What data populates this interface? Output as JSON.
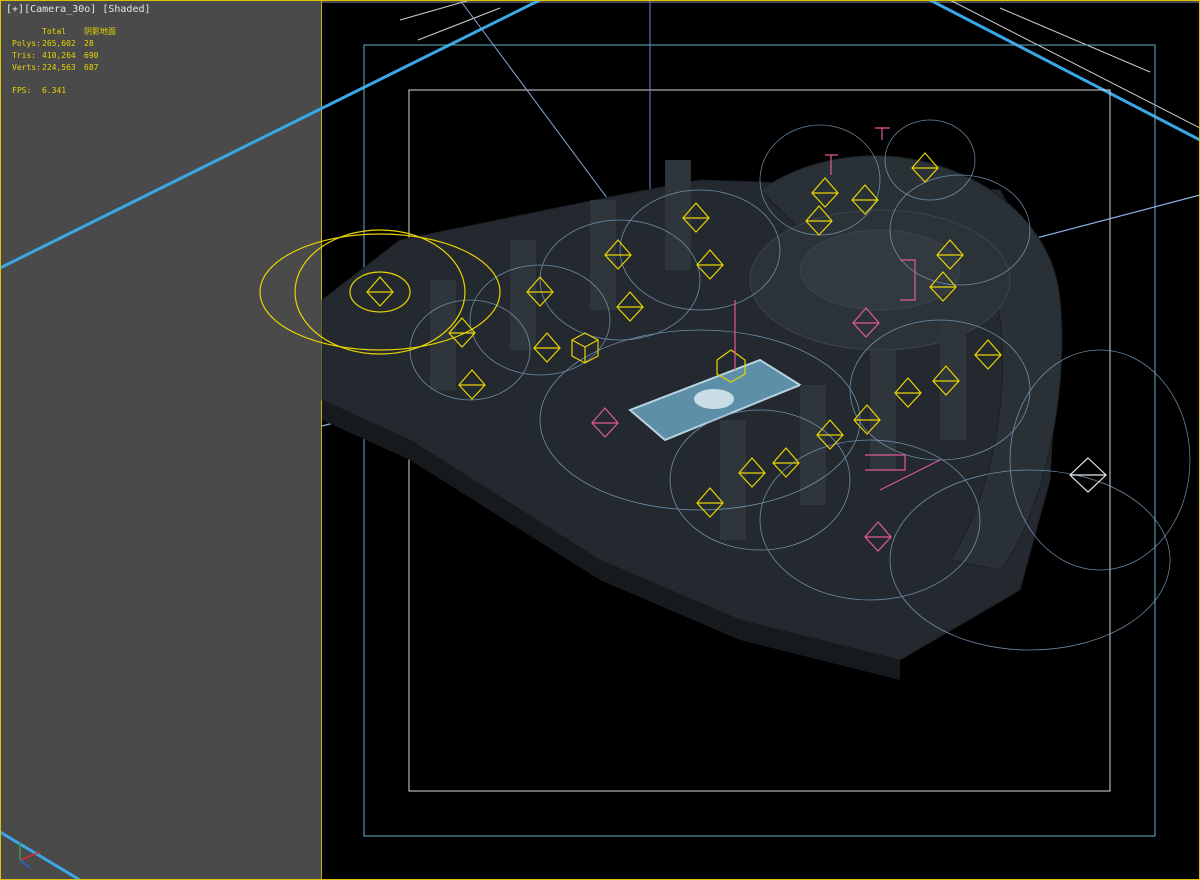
{
  "viewport": {
    "menu_label": "[+]",
    "camera_label": "[Camera_30o]",
    "shading_label": "[Shaded]"
  },
  "stats": {
    "col_total": "Total",
    "col_selection": "阴影地面",
    "rows": [
      {
        "label": "Polys:",
        "total": "265,602",
        "selection": "28"
      },
      {
        "label": "Tris:",
        "total": "410,264",
        "selection": "690"
      },
      {
        "label": "Verts:",
        "total": "224,563",
        "selection": "687"
      }
    ],
    "fps_label": "FPS:",
    "fps_value": "6.341"
  },
  "colors": {
    "background": "#000000",
    "panel_grey": "#4a4a4a",
    "active_border": "#d8c400",
    "safe_frame_outer": "#5fb3c8",
    "safe_frame_inner": "#d9d9d9",
    "light_gizmo": "#e8d400",
    "helper_pink": "#e05a9a",
    "camera_line": "#3aa7e8",
    "falloff_circle": "#7fa6c8"
  },
  "icons": {
    "axis": "axis-tripod-icon",
    "light": "omni-light-icon",
    "helper": "point-helper-icon"
  }
}
